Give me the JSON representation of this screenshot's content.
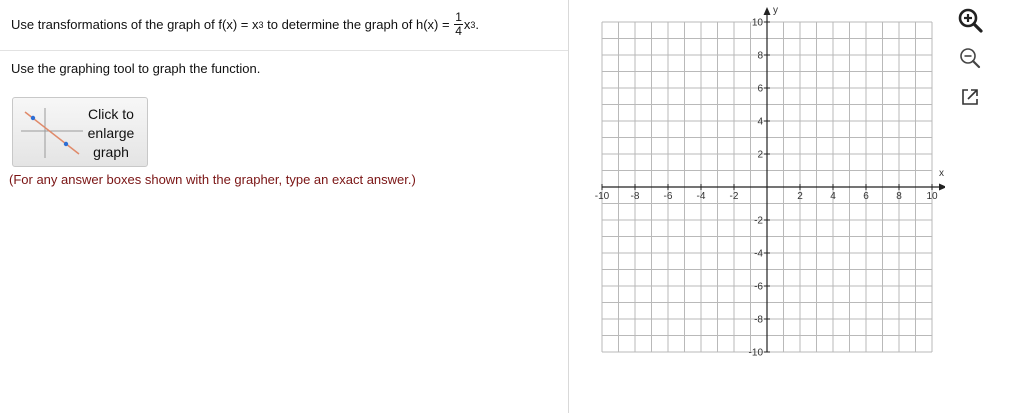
{
  "question": {
    "prefix": "Use transformations of the graph of f(x) = x",
    "f_exponent": "3",
    "middle": " to determine the graph of h(x) = ",
    "frac_num": "1",
    "frac_den": "4",
    "var": "x",
    "h_exponent": "3",
    "end": "."
  },
  "instruction": "Use the graphing tool to graph the function.",
  "enlarge_button": {
    "line1": "Click to",
    "line2": "enlarge",
    "line3": "graph"
  },
  "hint": "(For any answer boxes shown with the grapher, type an exact answer.)",
  "graph": {
    "x_axis_label": "x",
    "y_axis_label": "y",
    "x_tick_labels": [
      "-10",
      "-8",
      "-6",
      "-4",
      "-2",
      "2",
      "4",
      "6",
      "8",
      "10"
    ],
    "y_tick_labels": [
      "10",
      "8",
      "6",
      "4",
      "2",
      "-2",
      "-4",
      "-6",
      "-8",
      "-10"
    ],
    "x_range": [
      -10,
      10
    ],
    "y_range": [
      -10,
      10
    ],
    "grid_step": 1,
    "grid": true,
    "colors": {
      "grid": "#b9b9b9",
      "axis": "#222222"
    }
  },
  "toolbar": {
    "icons": [
      "zoom-in-icon",
      "zoom-out-icon",
      "open-external-icon"
    ]
  }
}
